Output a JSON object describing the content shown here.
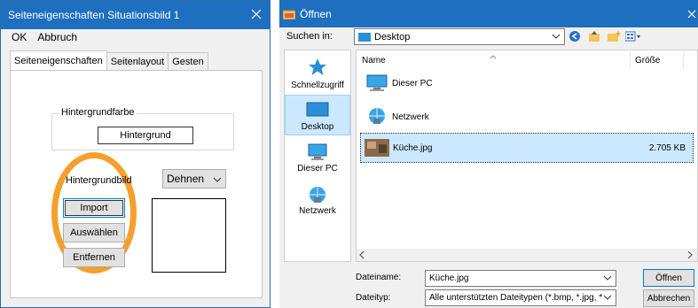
{
  "left_dialog": {
    "title": "Seiteneigenschaften Situationsbild 1",
    "close": "✕",
    "menu": [
      "OK",
      "Abbruch"
    ],
    "tabs": [
      "Seiteneigenschaften",
      "Seitenlayout",
      "Gesten"
    ],
    "background_color_group": "Hintergrundfarbe",
    "background_button": "Hintergrund",
    "background_image_label": "Hintergrundbild",
    "stretch_select": "Dehnen",
    "import_button": "Import",
    "select_button": "Auswählen",
    "remove_button": "Entfernen",
    "highlight_color": "#f5a02c"
  },
  "right_dialog": {
    "title": "Öffnen",
    "close": "✕",
    "search_label": "Suchen in:",
    "location": "Desktop",
    "places": [
      "Schnellzugriff",
      "Desktop",
      "Dieser PC",
      "Netzwerk"
    ],
    "columns": {
      "name": "Name",
      "size": "Größe"
    },
    "files": [
      {
        "name": "Dieser PC",
        "size": "",
        "icon": "computer-icon"
      },
      {
        "name": "Netzwerk",
        "size": "",
        "icon": "network-icon"
      },
      {
        "name": "Küche.jpg",
        "size": "2.705 KB",
        "icon": "image-thumbnail"
      }
    ],
    "filename_label": "Dateiname:",
    "filename_value": "Küche.jpg",
    "filetype_label": "Dateityp:",
    "filetype_value": "Alle unterstützten Dateitypen (*.bmp, *.jpg, *.jpe",
    "open_button": "Öffnen",
    "cancel_button": "Abbrechen",
    "accent_color": "#1e6fbf",
    "selection_color": "#cce8ff"
  }
}
